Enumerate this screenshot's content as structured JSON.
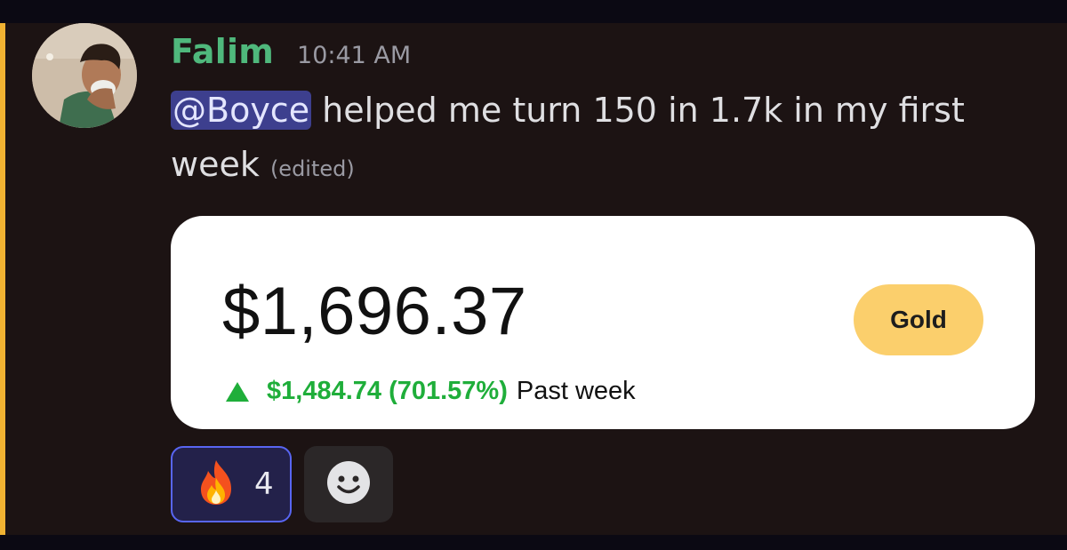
{
  "message": {
    "author": "Falim",
    "timestamp": "10:41 AM",
    "mention": "@Boyce",
    "text": " helped me turn 150 in 1.7k in my first week",
    "edited_label": "(edited)",
    "author_color": "#4fb87c",
    "highlight_color": "#f0b232"
  },
  "embed": {
    "balance": "$1,696.37",
    "badge_label": "Gold",
    "change_value": "$1,484.74 (701.57%)",
    "change_period": "Past week",
    "trend": "up",
    "trend_color": "#1fae3a",
    "badge_color": "#fbcf6c"
  },
  "reactions": [
    {
      "emoji": "fire-icon",
      "count": "4",
      "selected": true
    }
  ],
  "add_reaction": {
    "icon": "smiley-face-icon"
  }
}
